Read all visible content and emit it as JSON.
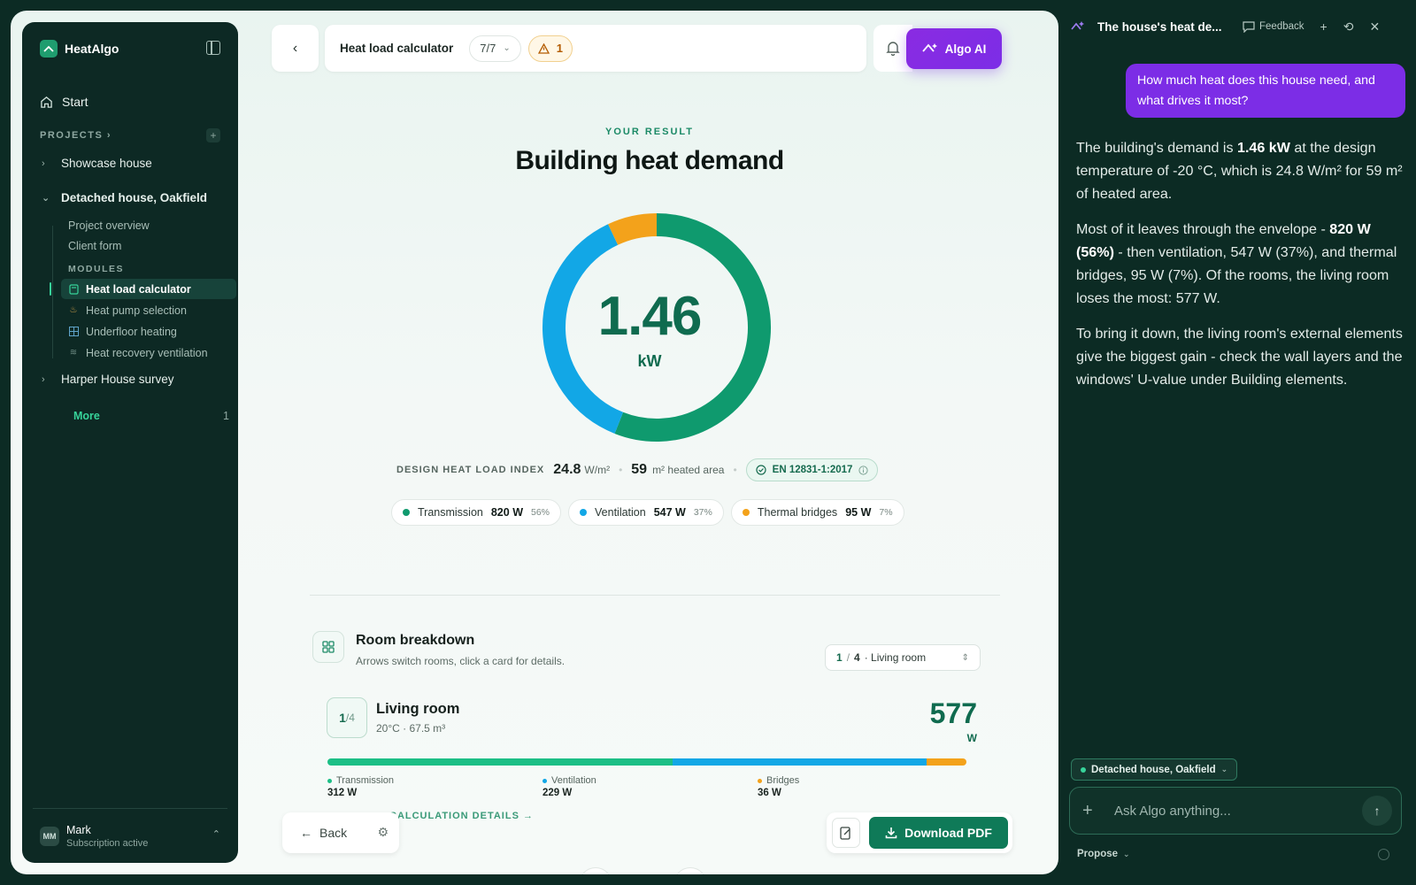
{
  "sidebar": {
    "brand": "HeatAlgo",
    "start": "Start",
    "projects_label": "PROJECTS",
    "projects": [
      {
        "label": "Showcase house"
      },
      {
        "label": "Detached house, Oakfield"
      },
      {
        "label": "Harper House survey"
      }
    ],
    "sub_items": [
      "Project overview",
      "Client form"
    ],
    "modules_label": "MODULES",
    "modules": [
      {
        "label": "Heat load calculator",
        "icon": "calculator-icon"
      },
      {
        "label": "Heat pump selection",
        "icon": "flame-icon"
      },
      {
        "label": "Underfloor heating",
        "icon": "grid-icon"
      },
      {
        "label": "Heat recovery ventilation",
        "icon": "airflow-icon"
      }
    ],
    "more_label": "More",
    "more_count": "1",
    "user": {
      "initials": "MM",
      "name": "Mark",
      "status": "Subscription active"
    }
  },
  "topbar": {
    "title": "Heat load calculator",
    "step": "7/7",
    "warnings": "1",
    "ai_button": "Algo AI"
  },
  "result": {
    "eyebrow": "YOUR RESULT",
    "title": "Building heat demand",
    "value": "1.46",
    "unit": "kW",
    "index_label": "DESIGN HEAT LOAD INDEX",
    "index_value": "24.8",
    "index_unit": "W/m²",
    "area_value": "59",
    "area_unit": "m² heated area",
    "standard": "EN 12831-1:2017",
    "components": [
      {
        "label": "Transmission",
        "value": "820 W",
        "pct": "56%",
        "share": 0.56,
        "color": "#0f9a6e"
      },
      {
        "label": "Ventilation",
        "value": "547 W",
        "pct": "37%",
        "share": 0.37,
        "color": "#12a7e6"
      },
      {
        "label": "Thermal bridges",
        "value": "95 W",
        "pct": "7%",
        "share": 0.07,
        "color": "#f3a21b"
      }
    ]
  },
  "rooms": {
    "title": "Room breakdown",
    "subtitle": "Arrows switch rooms, click a card for details.",
    "select": {
      "current": "1",
      "total": "4",
      "label": "· Living room"
    },
    "card": {
      "index": "1",
      "of": "/4",
      "name": "Living room",
      "meta": "20°C · 67.5 m³",
      "watts": "577",
      "unit": "W",
      "parts": [
        {
          "label": "Transmission",
          "value": "312 W",
          "watts": 312,
          "color": "#1cbf86"
        },
        {
          "label": "Ventilation",
          "value": "229 W",
          "watts": 229,
          "color": "#12a7e6"
        },
        {
          "label": "Bridges",
          "value": "36 W",
          "watts": 36,
          "color": "#f3a21b"
        }
      ],
      "details_link": "CALCULATION DETAILS →"
    }
  },
  "footer": {
    "back": "Back",
    "download": "Download PDF"
  },
  "chat": {
    "title": "The house's heat de...",
    "feedback": "Feedback",
    "user_message": "How much heat does this house need, and what drives it most?",
    "reply": [
      {
        "pre": "The building's demand is ",
        "bold": "1.46 kW",
        "post": " at the design temperature of -20 °C, which is 24.8 W/m² for 59 m² of heated area."
      },
      {
        "pre": "Most of it leaves through the envelope - ",
        "bold": "820 W (56%)",
        "post": " - then ventilation, 547 W (37%), and thermal bridges, 95 W (7%). Of the rooms, the living room loses the most: 577 W."
      },
      {
        "pre": "To bring it down, the living room's external elements give the biggest gain - check the wall layers and the windows' U-value under Building elements.",
        "bold": "",
        "post": ""
      }
    ],
    "context": "Detached house, Oakfield",
    "input_placeholder": "Ask Algo anything...",
    "mode": "Propose"
  }
}
